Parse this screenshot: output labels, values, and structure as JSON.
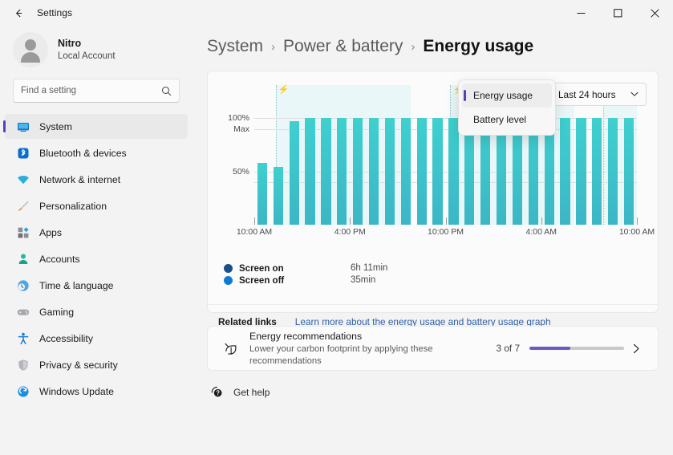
{
  "titlebar": {
    "back_label": "←",
    "title": "Settings",
    "minimize": "–",
    "maximize": "□",
    "close": "✕"
  },
  "profile": {
    "name": "Nitro",
    "account_type": "Local Account"
  },
  "search": {
    "placeholder": "Find a setting",
    "value": ""
  },
  "sidebar": {
    "items": [
      {
        "label": "System",
        "icon": "monitor-icon",
        "active": true
      },
      {
        "label": "Bluetooth & devices",
        "icon": "bluetooth-icon",
        "active": false
      },
      {
        "label": "Network & internet",
        "icon": "wifi-icon",
        "active": false
      },
      {
        "label": "Personalization",
        "icon": "paintbrush-icon",
        "active": false
      },
      {
        "label": "Apps",
        "icon": "apps-icon",
        "active": false
      },
      {
        "label": "Accounts",
        "icon": "person-icon",
        "active": false
      },
      {
        "label": "Time & language",
        "icon": "clock-globe-icon",
        "active": false
      },
      {
        "label": "Gaming",
        "icon": "gamepad-icon",
        "active": false
      },
      {
        "label": "Accessibility",
        "icon": "accessibility-icon",
        "active": false
      },
      {
        "label": "Privacy & security",
        "icon": "shield-icon",
        "active": false
      },
      {
        "label": "Windows Update",
        "icon": "update-icon",
        "active": false
      }
    ]
  },
  "breadcrumb": {
    "root": "System",
    "sep": "›",
    "mid": "Power & battery",
    "current": "Energy usage"
  },
  "chart_card": {
    "range_selector": {
      "value": "Last 24 hours",
      "chevron": "⌄"
    },
    "flyout": {
      "items": [
        {
          "label": "Energy usage",
          "selected": true
        },
        {
          "label": "Battery level",
          "selected": false
        }
      ]
    },
    "legend": {
      "rows": [
        {
          "label": "Screen on",
          "value": "6h 11min",
          "color": "#1b4f8a"
        },
        {
          "label": "Screen off",
          "value": "35min",
          "color": "#0f7ad4"
        }
      ]
    },
    "related": {
      "label": "Related links",
      "link": "Learn more about the energy usage and battery usage graph"
    }
  },
  "chart_data": {
    "type": "bar",
    "title": "Energy usage",
    "xlabel": "",
    "ylabel": "",
    "ylim": [
      0,
      110
    ],
    "grid": true,
    "legend_position": "below",
    "bar_color": "#3fc6cd",
    "y_ticks": [
      {
        "value": 100,
        "label": "100%"
      },
      {
        "value": 90,
        "label": "Max"
      },
      {
        "value": 50,
        "label": "50%"
      },
      {
        "value": 40,
        "label": ""
      }
    ],
    "x_ticks": [
      {
        "index": 0,
        "label": "10:00 AM"
      },
      {
        "index": 6,
        "label": "4:00 PM"
      },
      {
        "index": 12,
        "label": "10:00 PM"
      },
      {
        "index": 18,
        "label": "4:00 AM"
      },
      {
        "index": 24,
        "label": "10:00 AM"
      }
    ],
    "categories": [
      "10:00 AM",
      "11:00 AM",
      "12:00 PM",
      "1:00 PM",
      "2:00 PM",
      "3:00 PM",
      "4:00 PM",
      "5:00 PM",
      "6:00 PM",
      "7:00 PM",
      "8:00 PM",
      "9:00 PM",
      "10:00 PM",
      "11:00 PM",
      "12:00 AM",
      "1:00 AM",
      "2:00 AM",
      "3:00 AM",
      "4:00 AM",
      "5:00 AM",
      "6:00 AM",
      "7:00 AM",
      "8:00 AM",
      "9:00 AM"
    ],
    "values": [
      58,
      54,
      97,
      100,
      100,
      100,
      100,
      100,
      100,
      100,
      100,
      100,
      100,
      100,
      100,
      100,
      100,
      100,
      100,
      100,
      100,
      100,
      100,
      100
    ],
    "charging_periods": [
      {
        "start_index": 1.35,
        "end_index": 9.8,
        "marker": "⚡"
      },
      {
        "start_index": 12.3,
        "end_index": 20.1,
        "marker": "⚡"
      },
      {
        "start_index": 21.9,
        "end_index": 24.0,
        "marker": "⚡"
      }
    ]
  },
  "recommendations": {
    "icon": "leaf-icon",
    "title": "Energy recommendations",
    "subtitle": "Lower your carbon footprint by applying these recommendations",
    "count_label": "3 of 7",
    "progress_percent": 43,
    "progress_color": "#6b59c4",
    "chevron": "›"
  },
  "get_help": {
    "icon": "help-icon",
    "label": "Get help"
  }
}
